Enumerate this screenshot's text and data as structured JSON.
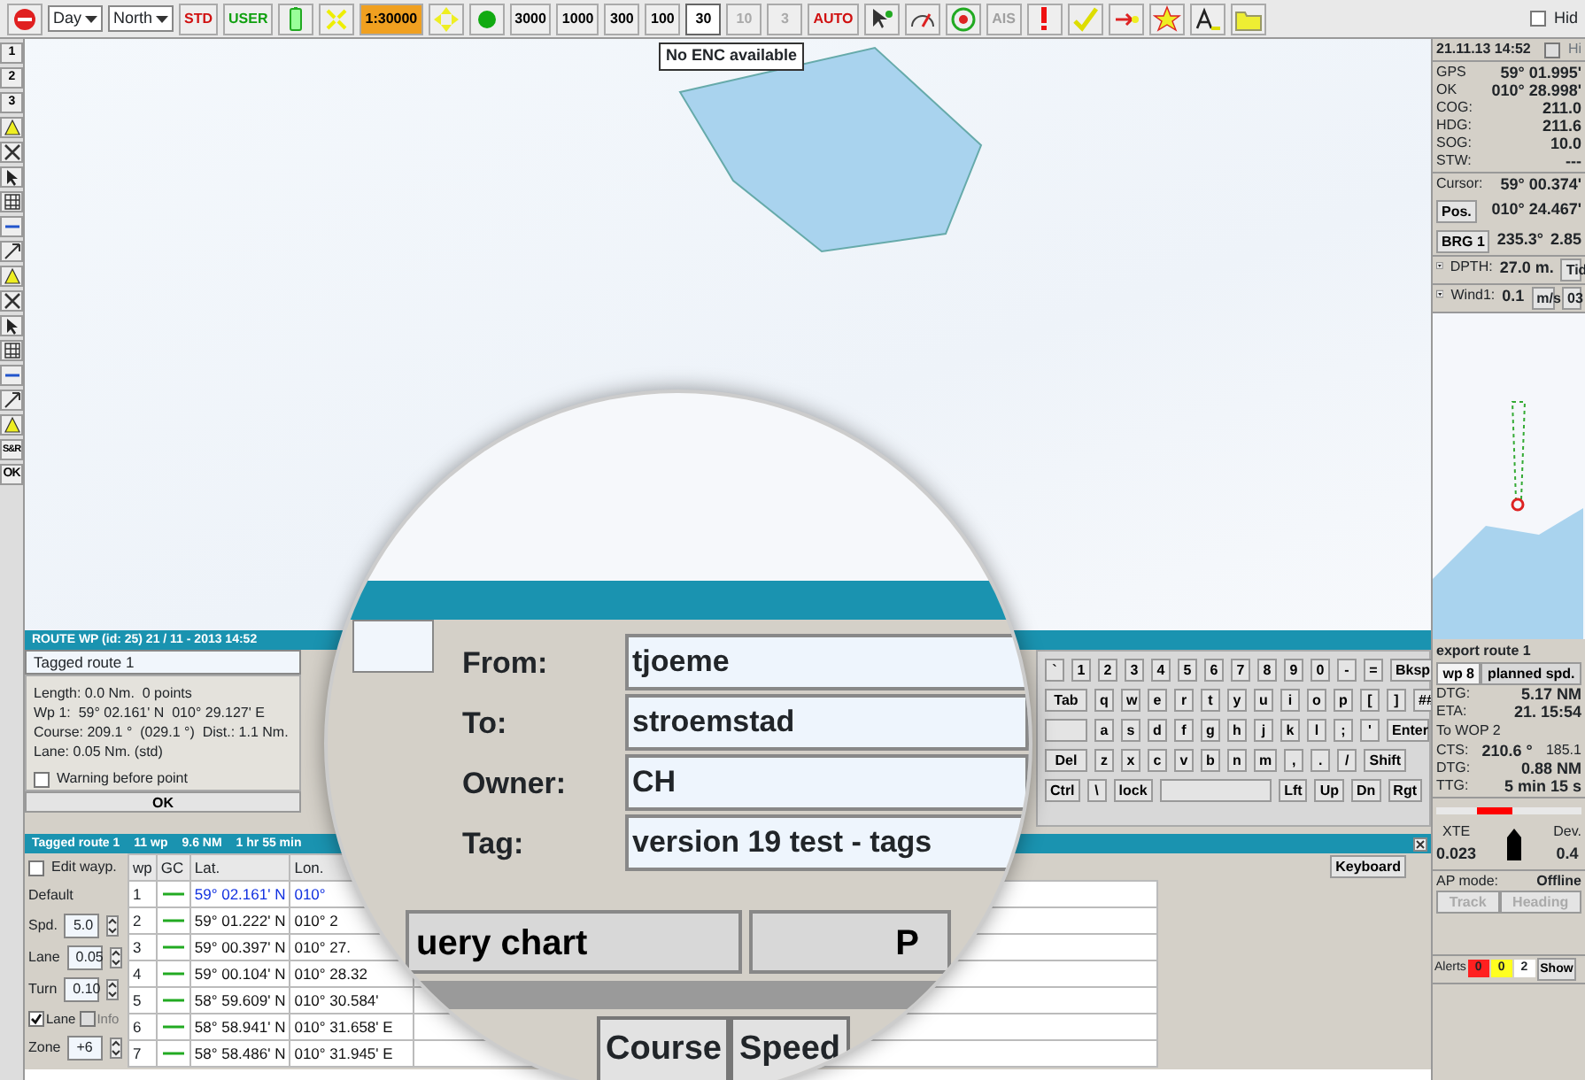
{
  "toolbar": [
    {
      "kind": "icon"
    },
    {
      "kind": "select",
      "value": "Day"
    },
    {
      "kind": "select",
      "value": "North"
    },
    {
      "kind": "label",
      "text": "STD",
      "color": "#d01010"
    },
    {
      "kind": "label",
      "text": "USER",
      "color": "#10a010"
    },
    {
      "kind": "icon"
    },
    {
      "kind": "icon"
    },
    {
      "kind": "badge",
      "text": "1:30000",
      "color": "#f0a020"
    },
    {
      "kind": "icon"
    },
    {
      "kind": "icon"
    },
    {
      "kind": "scale",
      "text": "3000",
      "selected": false,
      "disabled": false
    },
    {
      "kind": "scale",
      "text": "1000",
      "selected": false,
      "disabled": false
    },
    {
      "kind": "scale",
      "text": "300",
      "selected": false,
      "disabled": false
    },
    {
      "kind": "scale",
      "text": "100",
      "selected": false,
      "disabled": false
    },
    {
      "kind": "scale",
      "text": "30",
      "selected": true,
      "disabled": false
    },
    {
      "kind": "scale",
      "text": "10",
      "selected": false,
      "disabled": true
    },
    {
      "kind": "scale",
      "text": "3",
      "selected": false,
      "disabled": true
    },
    {
      "kind": "label",
      "text": "AUTO",
      "color": "#d01010"
    },
    {
      "kind": "icon"
    },
    {
      "kind": "icon"
    },
    {
      "kind": "icon"
    },
    {
      "kind": "label",
      "text": "AIS",
      "color": "#a0a0a0"
    },
    {
      "kind": "icon"
    },
    {
      "kind": "icon"
    },
    {
      "kind": "icon"
    },
    {
      "kind": "icon"
    },
    {
      "kind": "icon"
    },
    {
      "kind": "icon"
    },
    {
      "kind": "check",
      "label": "Hid",
      "checked": false
    }
  ],
  "side_tools": [
    {
      "kind": "label",
      "text": "1"
    },
    {
      "kind": "label",
      "text": "2"
    },
    {
      "kind": "label",
      "text": "3"
    },
    {
      "kind": "icon"
    },
    {
      "kind": "icon"
    },
    {
      "kind": "icon"
    },
    {
      "kind": "icon"
    },
    {
      "kind": "icon"
    },
    {
      "kind": "icon"
    },
    {
      "kind": "icon"
    },
    {
      "kind": "icon"
    },
    {
      "kind": "icon"
    },
    {
      "kind": "icon"
    },
    {
      "kind": "icon"
    },
    {
      "kind": "icon"
    },
    {
      "kind": "icon"
    },
    {
      "kind": "label",
      "text": "S&R"
    },
    {
      "kind": "label",
      "text": "OK"
    }
  ],
  "chart": {
    "notice": "No ENC available"
  },
  "route_wp_dialog": {
    "title": "ROUTE WP (id: 25) 21 / 11 - 2013 14:52",
    "name": "Tagged route 1",
    "info": [
      "Length: 0.0 Nm.  0 points",
      "Wp 1:  59° 02.161' N  010° 29.127' E",
      "Course: 209.1 °  (029.1 °)  Dist.: 1.1 Nm.",
      "Lane: 0.05 Nm. (std)"
    ],
    "warning": {
      "label": "Warning before point",
      "checked": false
    },
    "ok": "OK"
  },
  "keyboard": {
    "rows": [
      {
        "keys": [
          "`",
          "1",
          "2",
          "3",
          "4",
          "5",
          "6",
          "7",
          "8",
          "9",
          "0",
          "-",
          "=",
          "Bksp"
        ]
      },
      {
        "keys": [
          "Tab",
          "q",
          "w",
          "e",
          "r",
          "t",
          "y",
          "u",
          "i",
          "o",
          "p",
          "[",
          "]",
          "##"
        ]
      },
      {
        "blank_key": true,
        "keys": [
          "a",
          "s",
          "d",
          "f",
          "g",
          "h",
          "j",
          "k",
          "l",
          ";",
          "'",
          "Enter"
        ]
      },
      {
        "keys": [
          "Del",
          "z",
          "x",
          "c",
          "v",
          "b",
          "n",
          "m",
          ",",
          ".",
          "/",
          "Shift"
        ]
      }
    ],
    "bottom_left": [
      "Ctrl",
      "\\",
      "lock"
    ],
    "bottom_right": [
      "Lft",
      "Up",
      "Dn",
      "Rgt"
    ]
  },
  "route_panel": {
    "title": [
      "Tagged route 1",
      "11 wp",
      "9.6 NM",
      "1 hr 55 min"
    ],
    "edit": {
      "label": "Edit wayp.",
      "checked": false
    },
    "default_label": "Default",
    "spins": [
      {
        "label": "Spd.",
        "value": "5.0"
      },
      {
        "label": "Lane",
        "value": "0.05"
      },
      {
        "label": "Turn",
        "value": "0.10"
      }
    ],
    "lane": {
      "label": "Lane",
      "checked": true
    },
    "info": {
      "label": "Info",
      "checked": false,
      "disabled": true
    },
    "zone": {
      "label": "Zone",
      "value": "+6"
    },
    "columns": [
      "wp",
      "GC",
      "Lat.",
      "Lon."
    ],
    "rows": [
      {
        "wp": "1",
        "lat": "59° 02.161' N",
        "lon": "010°",
        "selected": true
      },
      {
        "wp": "2",
        "lat": "59° 01.222' N",
        "lon": "010° 2",
        "selected": false
      },
      {
        "wp": "3",
        "lat": "59° 00.397' N",
        "lon": "010° 27.",
        "selected": false
      },
      {
        "wp": "4",
        "lat": "59° 00.104' N",
        "lon": "010° 28.32",
        "selected": false
      },
      {
        "wp": "5",
        "lat": "58° 59.609' N",
        "lon": "010° 30.584'",
        "selected": false
      },
      {
        "wp": "6",
        "lat": "58° 58.941' N",
        "lon": "010° 31.658' E",
        "selected": false
      },
      {
        "wp": "7",
        "lat": "58° 58.486' N",
        "lon": "010° 31.945' E",
        "selected": false
      }
    ],
    "keyboard_button": "Keyboard"
  },
  "magnifier": {
    "fields": [
      {
        "label": "From:",
        "value": "tjoeme"
      },
      {
        "label": "To:",
        "value": "stroemstad"
      },
      {
        "label": "Owner:",
        "value": "CH"
      },
      {
        "label": "Tag:",
        "value": "version 19 test - tags"
      }
    ],
    "buttons": [
      "uery chart",
      "P"
    ],
    "columns": [
      "Course",
      "Speed"
    ]
  },
  "status": {
    "datetime": "21.11.13 14:52",
    "hide": {
      "label": "Hi",
      "checked": false
    },
    "nav": [
      {
        "label": "GPS",
        "value": "59° 01.995'"
      },
      {
        "label": "OK",
        "value": "010° 28.998'"
      },
      {
        "label": "COG:",
        "value": "211.0"
      },
      {
        "label": "HDG:",
        "value": "211.6"
      },
      {
        "label": "SOG:",
        "value": "10.0"
      },
      {
        "label": "STW:",
        "value": "---"
      }
    ],
    "cursor": {
      "label": "Cursor:",
      "lat": "59° 00.374'",
      "pos_button": "Pos.",
      "lon": "010° 24.467'",
      "brg_button": "BRG 1",
      "bearing": "235.3°",
      "distance": "2.85"
    },
    "depth": {
      "label": "DPTH:",
      "value": "27.0 m.",
      "extra": "Tid"
    },
    "wind": {
      "label": "Wind1:",
      "value": "0.1",
      "unit": "m/s",
      "extra": "03"
    }
  },
  "route_status": {
    "title": "export route 1",
    "tabs": [
      {
        "label": "wp 8",
        "selected": true
      },
      {
        "label": "planned spd.",
        "selected": false
      }
    ],
    "rows_a": [
      {
        "label": "DTG:",
        "value": "5.17 NM"
      },
      {
        "label": "ETA:",
        "value": "21. 15:54"
      }
    ],
    "to_wp": "To WOP 2",
    "cts": {
      "label": "CTS:",
      "value": "210.6 °",
      "extra": "185.1"
    },
    "rows_b": [
      {
        "label": "DTG:",
        "value": "0.88 NM"
      },
      {
        "label": "TTG:",
        "value": "5 min 15 s"
      }
    ],
    "xte": {
      "label": "XTE",
      "value": "0.023",
      "level": 0.4
    },
    "dev": {
      "label": "Dev.",
      "value": "0.4"
    },
    "ap": {
      "label": "AP mode:",
      "value": "Offline",
      "buttons": [
        {
          "label": "Track",
          "disabled": true
        },
        {
          "label": "Heading",
          "disabled": true
        }
      ]
    },
    "alerts": {
      "label": "Alerts",
      "counts": [
        {
          "value": "0",
          "color": "#ff2020"
        },
        {
          "value": "0",
          "color": "#ffff20"
        },
        {
          "value": "2",
          "color": "#ffffff"
        }
      ],
      "show": "Show"
    }
  }
}
